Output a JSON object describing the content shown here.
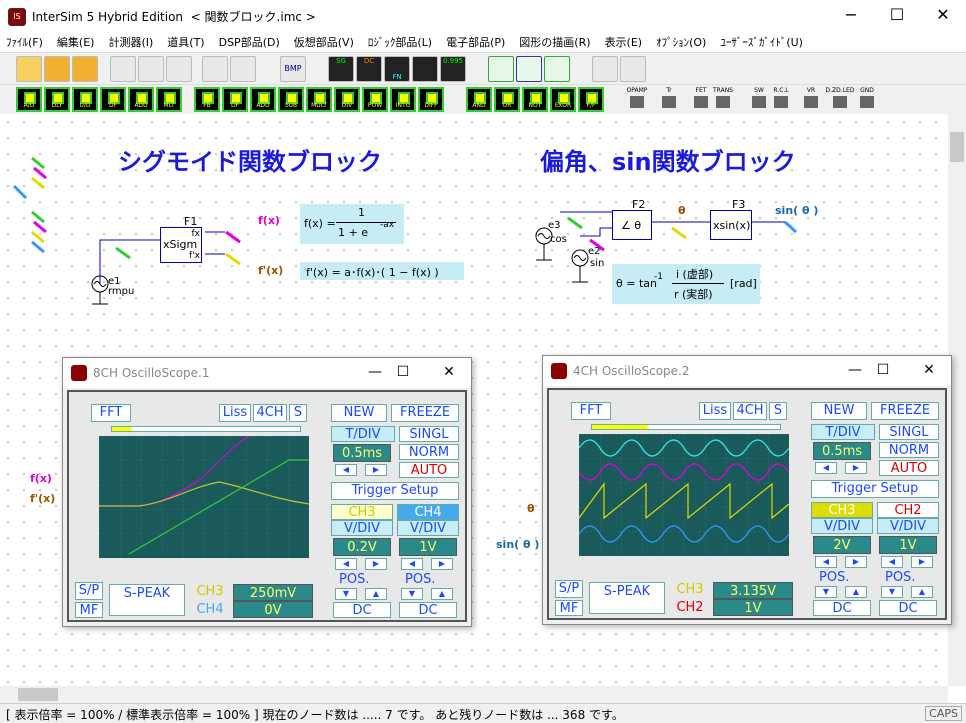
{
  "window": {
    "app": "InterSim 5  Hybrid Edition",
    "file": "< 関数ブロック.imc >",
    "icon": "app-icon"
  },
  "menu": [
    "ﾌｧｲﾙ(F)",
    "編集(E)",
    "計測器(I)",
    "道具(T)",
    "DSP部品(D)",
    "仮想部品(V)",
    "ﾛｼﾞｯｸ部品(L)",
    "電子部品(P)",
    "図形の描画(R)",
    "表示(E)",
    "ｵﾌﾟｼｮﾝ(O)",
    "ﾕｰｻﾞｰｽﾞｶﾞｲﾄﾞ(U)"
  ],
  "toolbar2": [
    "A/D",
    "DLY",
    "U/D",
    "DF",
    "ADD",
    "MLT",
    "FB",
    "DF",
    "ADD",
    "SUB",
    "MULT",
    "DIV",
    "POW",
    "INTG",
    "DIFF",
    "AND",
    "OR",
    "NOT",
    "ExOR",
    "F/F"
  ],
  "toolbar2b": [
    "OPAMP",
    "Tr",
    "FET",
    "TRANS",
    "SW",
    "R.C.L",
    "VR",
    "D.ZD.LED",
    "GND"
  ],
  "toolbar1_labels": {
    "bmp": "BMP",
    "sg": "SG",
    "dc": "DC",
    "fn": "FN",
    "dmm": "DMM",
    "counter": "0.995"
  },
  "canvas": {
    "left_heading": "シグモイド関数ブロック",
    "right_heading": "偏角、sin関数ブロック",
    "left": {
      "block_name": "F1",
      "block_text": "xSigm",
      "fx_out": "fx",
      "fpx_out": "f'x",
      "source": "e1",
      "source_name": "rmpu",
      "in_node": "1",
      "out2": "2",
      "out3": "3",
      "label_fx": "f(x)",
      "label_fpx": "f'(x)",
      "formula1": {
        "lhs": "f(x) =",
        "num": "1",
        "den": "1 + e",
        "exp": "-ax"
      },
      "formula2": "f'(x) = a･f(x)･( 1 − f(x) )"
    },
    "right": {
      "block2": "F2",
      "block2_text": "∠ θ",
      "block3": "F3",
      "block3_text": "xsin(x)",
      "src1": "e3",
      "src1_name": "cos",
      "src2": "e2",
      "src2_name": "sin",
      "label_theta": "θ",
      "label_sin": "sin( θ )",
      "n1": "1",
      "n2": "2",
      "n3": "3",
      "n4": "4",
      "formula": {
        "lhs": "θ = tan",
        "exp": "-1",
        "num": "i (虚部)",
        "den": "r (実部)",
        "unit": "[rad]"
      }
    },
    "probes_left": [
      "1",
      "2",
      "3",
      "4",
      "1",
      "2",
      "3",
      "4"
    ]
  },
  "osc8": {
    "title": "8CH OscilloScope.1",
    "fft": "FFT",
    "liss": "Liss",
    "ch_mode": "4CH",
    "s": "S",
    "new": "NEW",
    "freeze": "FREEZE",
    "tdiv": "T/DIV",
    "singl": "SINGL",
    "tdiv_val": "0.5ms",
    "norm": "NORM",
    "auto": "AUTO",
    "trigger": "Trigger Setup",
    "cha": "CH3",
    "chb": "CH4",
    "vdiv": "V/DIV",
    "vdiv_a": "0.2V",
    "vdiv_b": "1V",
    "pos": "POS.",
    "dc": "DC",
    "sp": "S/P",
    "mf": "MF",
    "speak": "S-PEAK",
    "meas_ch_a": "CH3",
    "meas_ch_b": "CH4",
    "meas_a": "250mV",
    "meas_b": "0V",
    "side_labels": [
      "f(x)",
      "f'(x)"
    ]
  },
  "osc4": {
    "title": "4CH OscilloScope.2",
    "fft": "FFT",
    "liss": "Liss",
    "ch_mode": "4CH",
    "s": "S",
    "new": "NEW",
    "freeze": "FREEZE",
    "tdiv": "T/DIV",
    "singl": "SINGL",
    "tdiv_val": "0.5ms",
    "norm": "NORM",
    "auto": "AUTO",
    "trigger": "Trigger Setup",
    "cha": "CH3",
    "chb": "CH2",
    "vdiv": "V/DIV",
    "vdiv_a": "2V",
    "vdiv_b": "1V",
    "pos": "POS.",
    "dc": "DC",
    "sp": "S/P",
    "mf": "MF",
    "speak": "S-PEAK",
    "meas_ch_a": "CH3",
    "meas_ch_b": "CH2",
    "meas_a": "3.135V",
    "meas_b": "1V",
    "side_labels": [
      "θ",
      "sin( θ )"
    ]
  },
  "status": {
    "text": "[ 表示倍率 = 100% / 標準表示倍率 = 100% ] 現在のノード数は ..... 7 です。 あと残りノード数は ... 368 です。",
    "caps": "CAPS"
  },
  "colors": {
    "heading": "#1a1adc",
    "fx": "#e000e0",
    "fpx": "#a05000",
    "theta": "#a05000",
    "sin": "#1a6aaa",
    "screen": "#1a5a5a",
    "grid": "#3a8a8a"
  }
}
